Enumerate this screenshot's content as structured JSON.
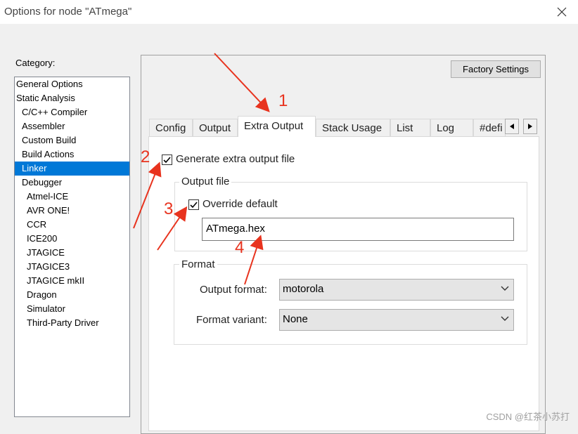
{
  "window": {
    "title": "Options for node \"ATmega\"",
    "close_icon": "close-icon"
  },
  "category": {
    "label": "Category:",
    "items": [
      {
        "label": "General Options",
        "level": 0
      },
      {
        "label": "Static Analysis",
        "level": 0
      },
      {
        "label": "C/C++ Compiler",
        "level": 1
      },
      {
        "label": "Assembler",
        "level": 1
      },
      {
        "label": "Custom Build",
        "level": 1
      },
      {
        "label": "Build Actions",
        "level": 1
      },
      {
        "label": "Linker",
        "level": 1,
        "selected": true
      },
      {
        "label": "Debugger",
        "level": 1
      },
      {
        "label": "Atmel-ICE",
        "level": 2
      },
      {
        "label": "AVR ONE!",
        "level": 2
      },
      {
        "label": "CCR",
        "level": 2
      },
      {
        "label": "ICE200",
        "level": 2
      },
      {
        "label": "JTAGICE",
        "level": 2
      },
      {
        "label": "JTAGICE3",
        "level": 2
      },
      {
        "label": "JTAGICE mkII",
        "level": 2
      },
      {
        "label": "Dragon",
        "level": 2
      },
      {
        "label": "Simulator",
        "level": 2
      },
      {
        "label": "Third-Party Driver",
        "level": 2
      }
    ]
  },
  "factory_settings_label": "Factory Settings",
  "tabs": [
    {
      "label": "Config"
    },
    {
      "label": "Output"
    },
    {
      "label": "Extra Output",
      "active": true
    },
    {
      "label": "Stack Usage"
    },
    {
      "label": "List"
    },
    {
      "label": "Log"
    },
    {
      "label": "#defi"
    }
  ],
  "extra_output": {
    "generate_label": "Generate extra output file",
    "generate_checked": true,
    "output_file_group": "Output file",
    "override_label": "Override default",
    "override_checked": true,
    "filename": "ATmega.hex",
    "format_group": "Format",
    "output_format_label": "Output format:",
    "output_format_value": "motorola",
    "format_variant_label": "Format variant:",
    "format_variant_value": "None"
  },
  "annotations": [
    "1",
    "2",
    "3",
    "4"
  ],
  "annotation_color": "#e8331e",
  "accent_color": "#0078d7",
  "watermark": "CSDN @红茶小苏打"
}
